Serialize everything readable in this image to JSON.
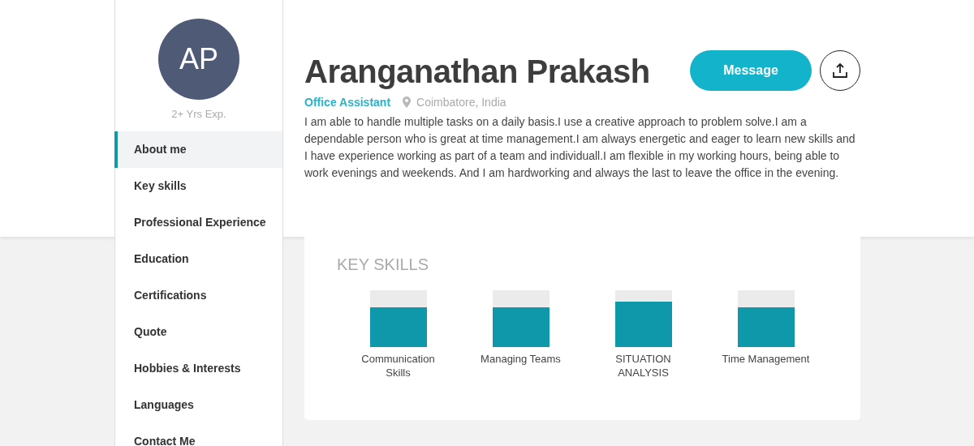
{
  "profile": {
    "initials": "AP",
    "experience": "2+ Yrs Exp.",
    "name": "Aranganathan Prakash",
    "role": "Office Assistant",
    "location": "Coimbatore, India",
    "about": "I am able to handle multiple tasks on a daily basis.I use a creative approach to problem solve.I am a dependable person who is great at time management.I am always energetic and eager to learn new skills and I have experience working as part of a team and individuall.I am flexible in my working hours, being able to work evenings and weekends. And I am hardworking and always the last to leave the office in the evening."
  },
  "message_button": "Message",
  "nav": [
    {
      "label": "About me",
      "selected": true
    },
    {
      "label": "Key skills",
      "selected": false
    },
    {
      "label": "Professional Experience",
      "selected": false
    },
    {
      "label": "Education",
      "selected": false
    },
    {
      "label": "Certifications",
      "selected": false
    },
    {
      "label": "Quote",
      "selected": false
    },
    {
      "label": "Hobbies & Interests",
      "selected": false
    },
    {
      "label": "Languages",
      "selected": false
    },
    {
      "label": "Contact Me",
      "selected": false
    }
  ],
  "key_skills": {
    "title": "KEY SKILLS",
    "skills": [
      {
        "name": "Communication Skills"
      },
      {
        "name": "Managing Teams"
      },
      {
        "name": "SITUATION ANALYSIS"
      },
      {
        "name": "Time Management"
      }
    ]
  }
}
